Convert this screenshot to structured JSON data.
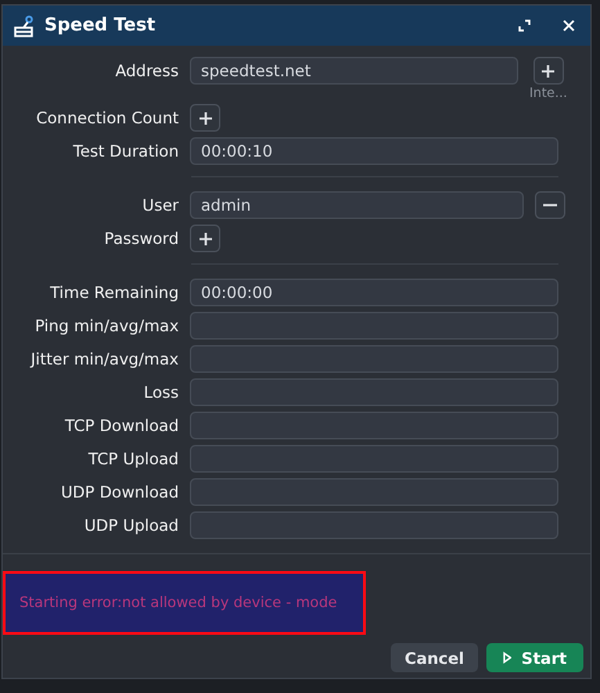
{
  "window": {
    "title": "Speed Test"
  },
  "sections": [
    {
      "rows": [
        {
          "label": "Address",
          "kind": "text",
          "value": "speedtest.net",
          "buttons": [
            {
              "kind": "add",
              "hint": "Inte..."
            }
          ]
        },
        {
          "label": "Connection Count",
          "kind": "add"
        },
        {
          "label": "Test Duration",
          "kind": "text",
          "value": "00:00:10"
        }
      ]
    },
    {
      "rows": [
        {
          "label": "User",
          "kind": "text",
          "value": "admin",
          "buttons": [
            {
              "kind": "remove"
            }
          ]
        },
        {
          "label": "Password",
          "kind": "add"
        }
      ]
    },
    {
      "rows": [
        {
          "label": "Time Remaining",
          "kind": "text",
          "value": "00:00:00"
        },
        {
          "label": "Ping min/avg/max",
          "kind": "text"
        },
        {
          "label": "Jitter min/avg/max",
          "kind": "text"
        },
        {
          "label": "Loss",
          "kind": "text"
        },
        {
          "label": "TCP Download",
          "kind": "text"
        },
        {
          "label": "TCP Upload",
          "kind": "text"
        },
        {
          "label": "UDP Download",
          "kind": "text"
        },
        {
          "label": "UDP Upload",
          "kind": "text"
        }
      ]
    }
  ],
  "status": {
    "message": "Starting error:not allowed by device - mode",
    "highlighted": true
  },
  "buttons": [
    {
      "label": "Cancel",
      "kind": "secondary"
    },
    {
      "label": "Start",
      "kind": "primary"
    }
  ]
}
